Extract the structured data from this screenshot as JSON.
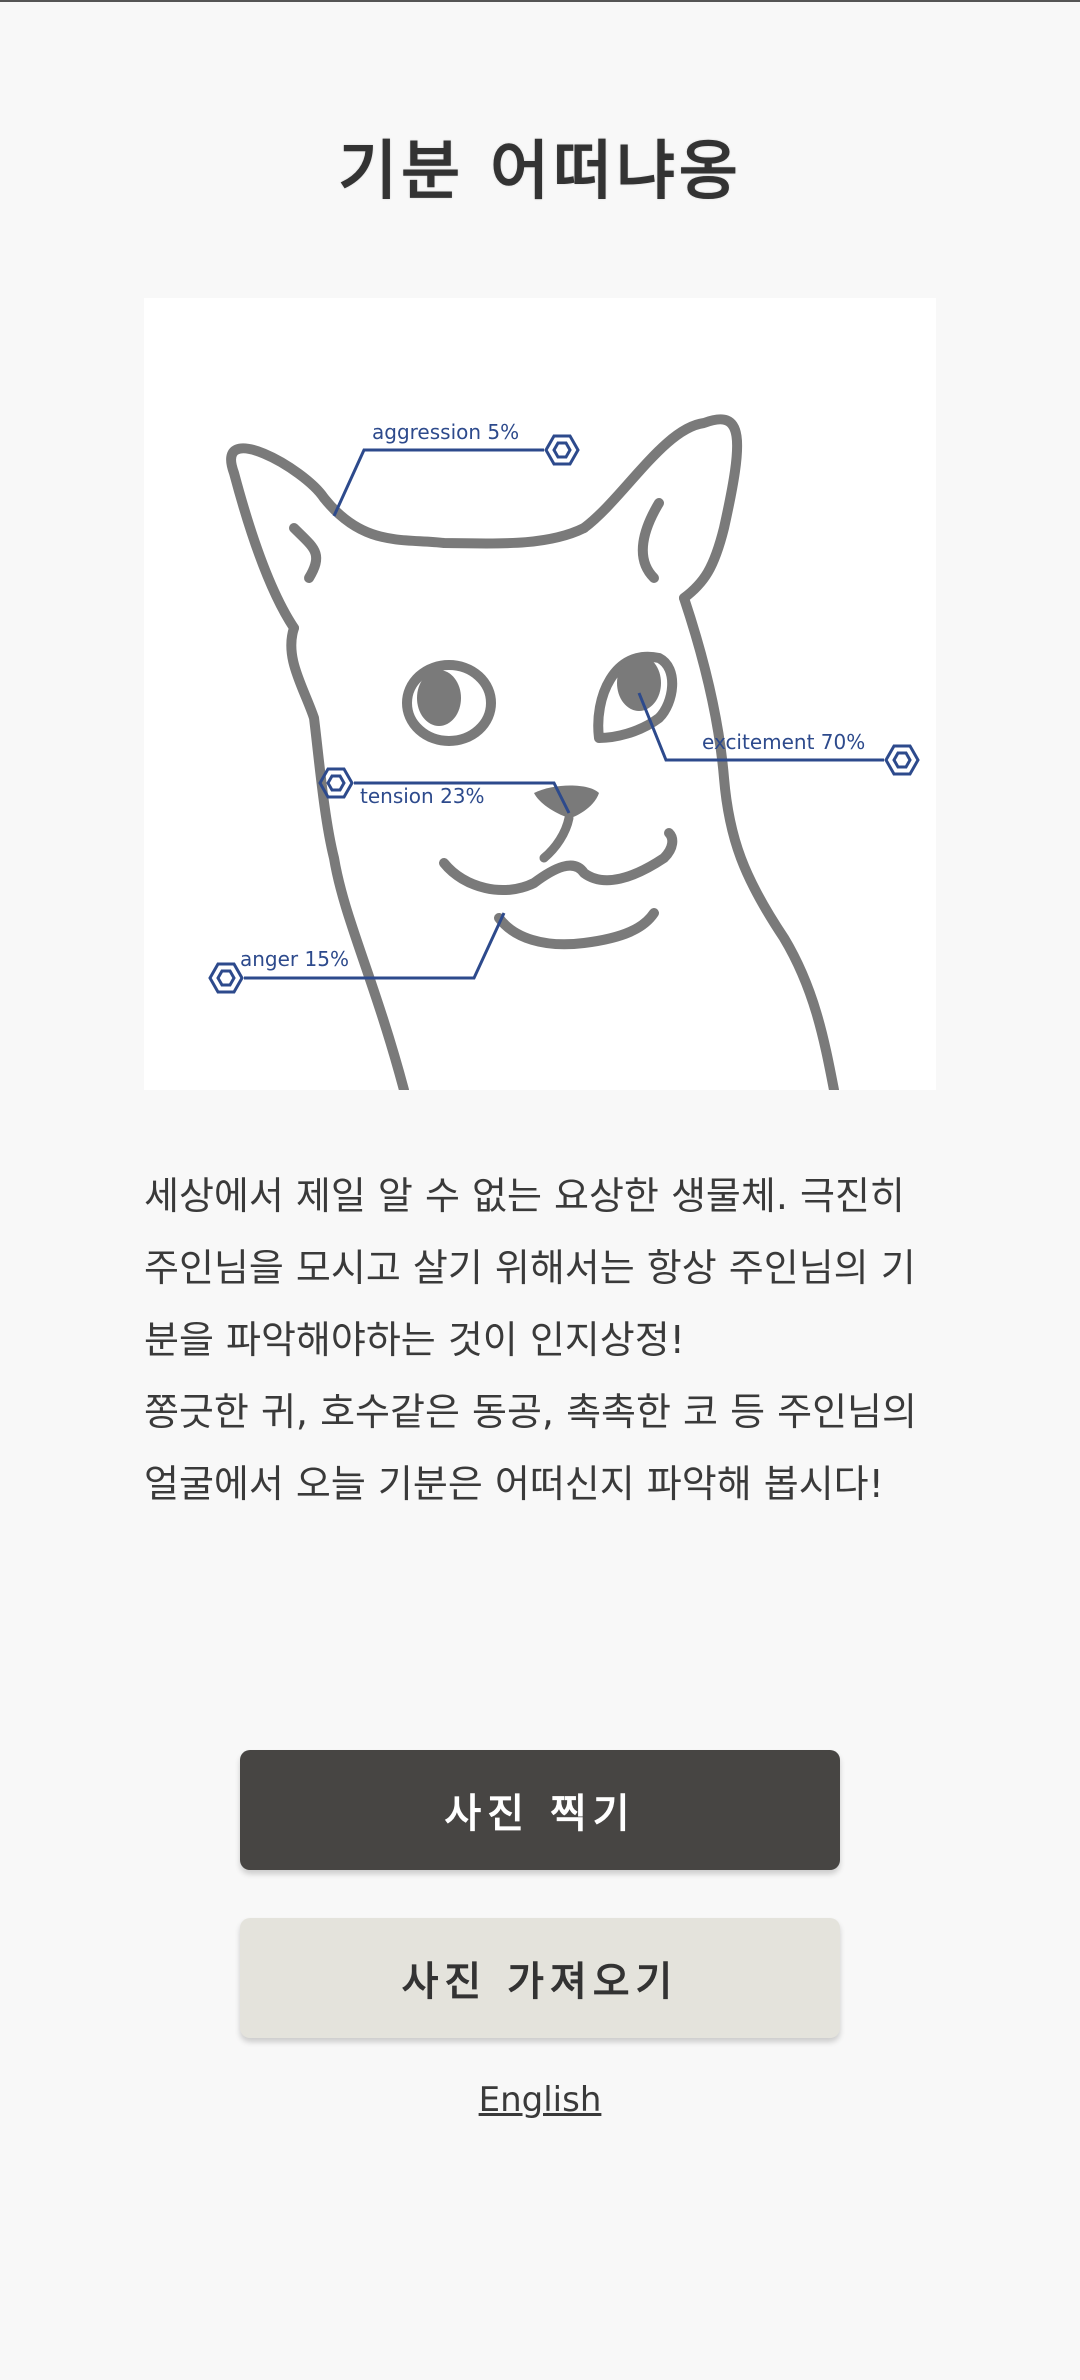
{
  "app": {
    "title": "기분 어떠냐옹"
  },
  "illustration": {
    "labels": {
      "aggression": "aggression 5%",
      "excitement": "excitement 70%",
      "tension": "tension 23%",
      "anger": "anger 15%"
    },
    "colors": {
      "line": "#2d4a8c",
      "sketch": "#7a7a7a"
    }
  },
  "description": {
    "paragraph1": "세상에서 제일 알 수 없는 요상한 생물체. 극진히 주인님을 모시고 살기 위해서는 항상 주인님의 기분을 파악해야하는 것이 인지상정!",
    "paragraph2": "쫑긋한 귀, 호수같은 동공, 촉촉한 코 등 주인님의 얼굴에서 오늘 기분은 어떠신지 파악해 봅시다!"
  },
  "buttons": {
    "take_photo": "사진 찍기",
    "import_photo": "사진 가져오기"
  },
  "language_link": "English",
  "colors": {
    "background": "#f8f8f8",
    "primary_button": "#474543",
    "secondary_button": "#e4e3dc"
  }
}
